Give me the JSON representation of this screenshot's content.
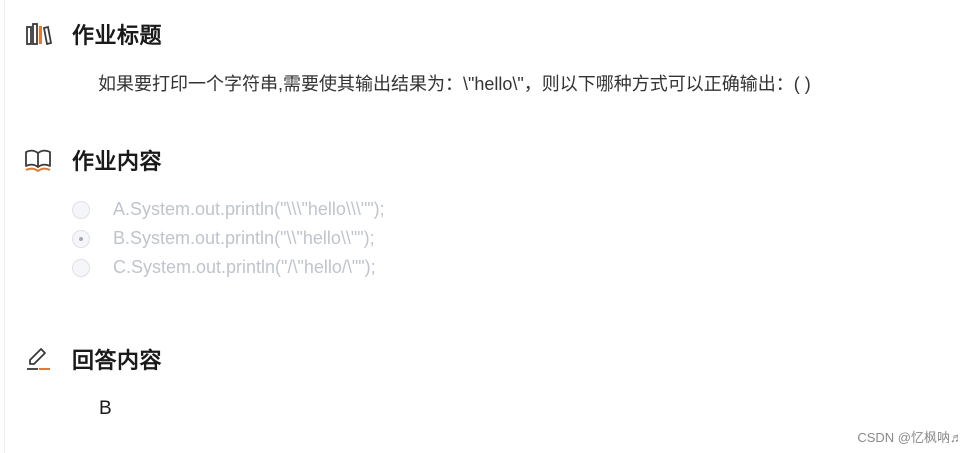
{
  "sections": {
    "title": {
      "heading": "作业标题",
      "icon": "books-icon",
      "text": "如果要打印一个字符串,需要使其输出结果为：\\\"hello\\\"，则以下哪种方式可以正确输出：( )"
    },
    "content": {
      "heading": "作业内容",
      "icon": "open-book-icon",
      "options": [
        {
          "label": "A.System.out.println(\"\\\\\\\"hello\\\\\\\"\");",
          "selected": false
        },
        {
          "label": "B.System.out.println(\"\\\\\"hello\\\\\"\");",
          "selected": true
        },
        {
          "label": "C.System.out.println(\"/\\\"hello/\\\"\");",
          "selected": false
        }
      ]
    },
    "answer": {
      "heading": "回答内容",
      "icon": "edit-pen-icon",
      "text": "B"
    }
  },
  "watermark": "CSDN @忆枫呐♬",
  "colors": {
    "accent_orange": "#e8782a",
    "icon_dark": "#3a3a3a",
    "option_disabled": "#c0c4cc"
  }
}
